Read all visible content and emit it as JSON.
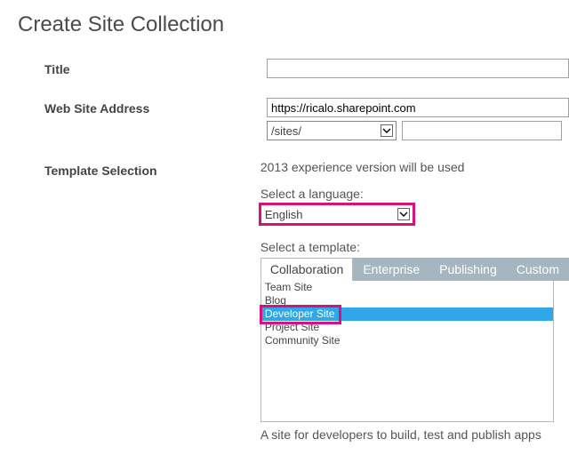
{
  "heading": "Create Site Collection",
  "labels": {
    "title": "Title",
    "address": "Web Site Address",
    "template": "Template Selection"
  },
  "title_value": "",
  "address": {
    "base": "https://ricalo.sharepoint.com",
    "path_selected": "/sites/",
    "suffix": ""
  },
  "template": {
    "note": "2013 experience version will be used",
    "lang_label": "Select a language:",
    "lang_value": "English",
    "tmpl_label": "Select a template:",
    "tabs": [
      "Collaboration",
      "Enterprise",
      "Publishing",
      "Custom"
    ],
    "items": [
      "Team Site",
      "Blog",
      "Developer Site",
      "Project Site",
      "Community Site"
    ],
    "desc": "A site for developers to build, test and publish apps"
  }
}
